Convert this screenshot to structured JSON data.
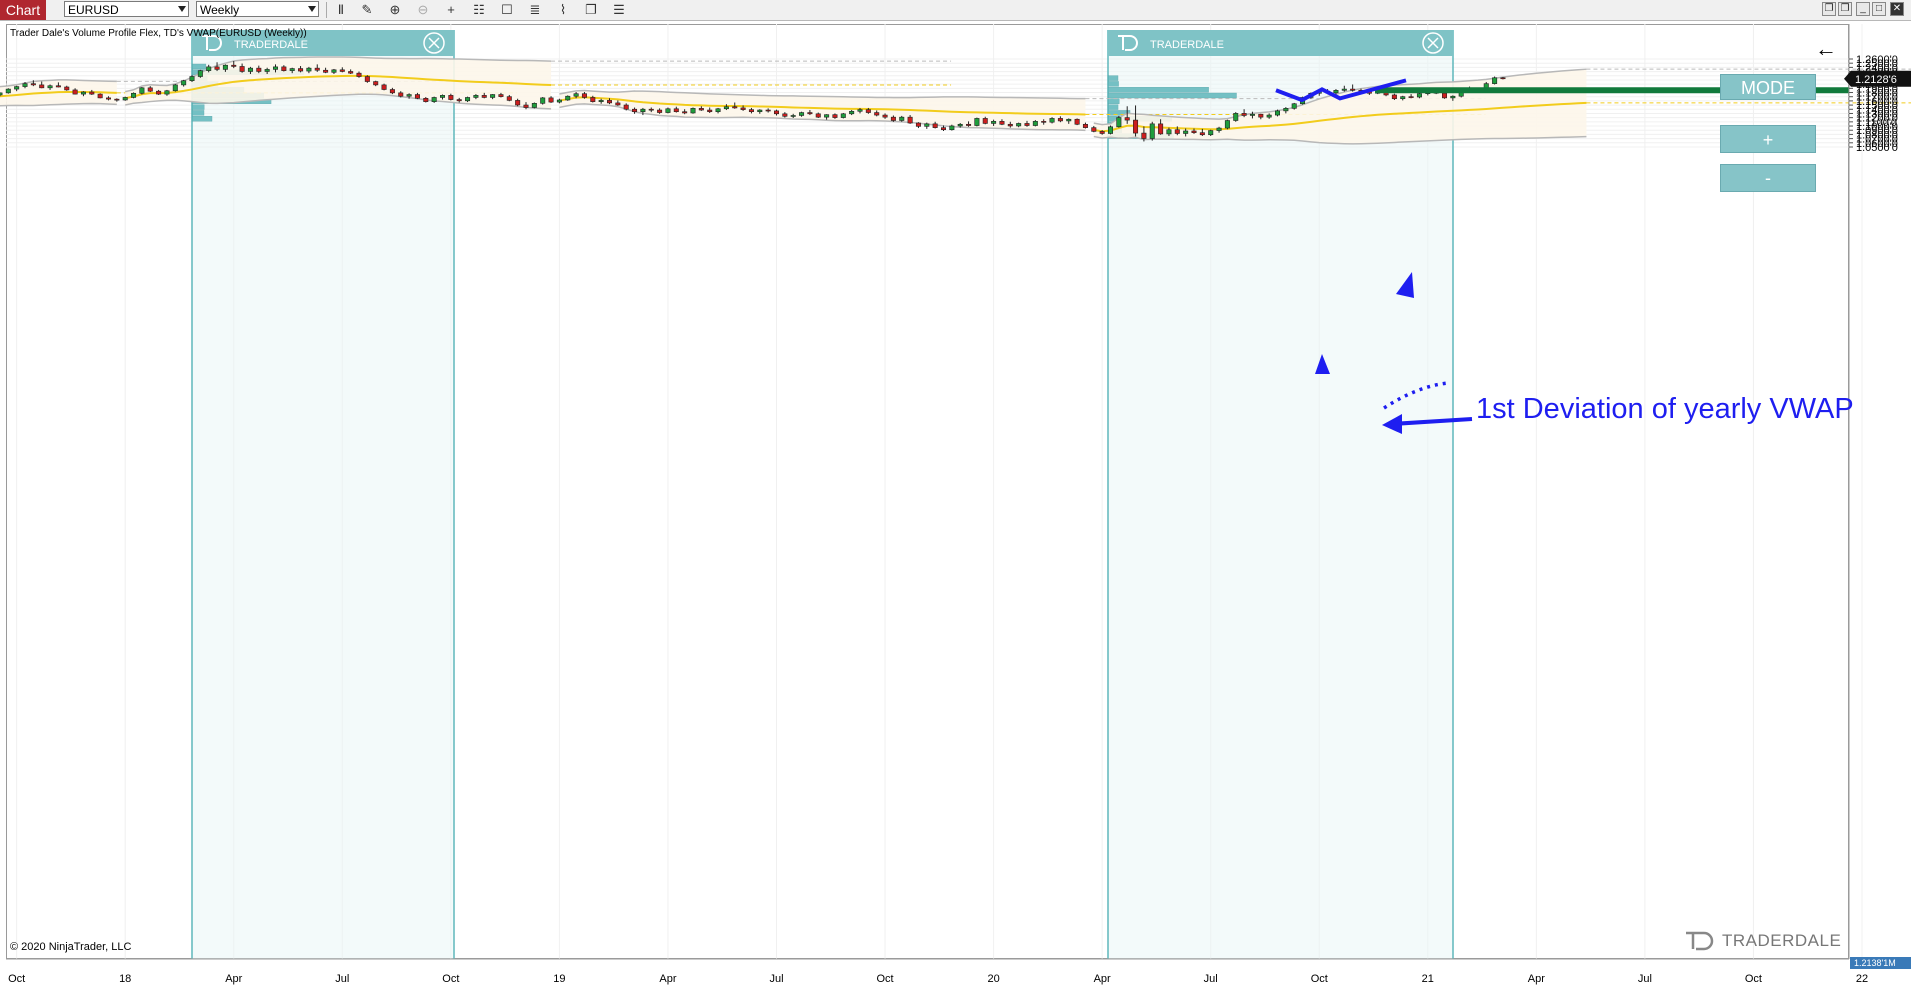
{
  "toolbar": {
    "tab_label": "Chart",
    "instrument": "EURUSD",
    "timeframe": "Weekly",
    "icons": [
      "bar-type-icon",
      "draw-pencil-icon",
      "zoom-in-icon",
      "zoom-out-icon",
      "crosshair-icon",
      "properties-icon",
      "data-box-icon",
      "strategy-icon",
      "indicator-icon",
      "menu-icon"
    ]
  },
  "window_buttons": [
    "restore",
    "restore",
    "minimize",
    "maximize",
    "close"
  ],
  "indicator_label": "Trader Dale's Volume Profile Flex, TD's VWAP(EURUSD (Weekly))",
  "copyright": "© 2020 NinjaTrader, LLC",
  "panel": {
    "mode": "MODE",
    "plus": "+",
    "minus": "-"
  },
  "profile_header_text": "TRADERDALE",
  "brand": "TRADERDALE",
  "annotation": "1st Deviation of yearly VWAP",
  "price_tag": "1.2128'6",
  "bottom_tag": "1.2138'1M",
  "colors": {
    "bull": "#1f9d3c",
    "bear": "#cc1e1e",
    "vwap": "#f2cc1c",
    "band": "#b8b8b8",
    "profile": "#5fb7bb",
    "profile_bg": "#eaf6f6",
    "annotation": "#1e1ef0",
    "level_line": "#117a3c",
    "brand_red": "#b0272f"
  },
  "chart_data": {
    "type": "candlestick",
    "instrument": "EURUSD",
    "timeframe": "Weekly",
    "y_axis_labels": [
      "1.2600'0",
      "1.2500'0",
      "1.2400'0",
      "1.2300'0",
      "1.2200'0",
      "1.2100'0",
      "1.2000'0",
      "1.1900'0",
      "1.1800'0",
      "1.1700'0",
      "1.1600'0",
      "1.1500'0",
      "1.1400'0",
      "1.1300'0",
      "1.1200'0",
      "1.1100'0",
      "1.1000'0",
      "1.0900'0",
      "1.0800'0",
      "1.0700'0",
      "1.0600'0",
      "1.0500'0"
    ],
    "y_axis_values": [
      1.26,
      1.25,
      1.24,
      1.23,
      1.22,
      1.21,
      1.2,
      1.19,
      1.18,
      1.17,
      1.16,
      1.15,
      1.14,
      1.13,
      1.12,
      1.11,
      1.1,
      1.09,
      1.08,
      1.07,
      1.06,
      1.05
    ],
    "ylim": [
      1.046,
      1.264
    ],
    "x_axis_labels": [
      "Oct",
      "18",
      "Apr",
      "Jul",
      "Oct",
      "19",
      "Apr",
      "Jul",
      "Oct",
      "20",
      "Apr",
      "Jul",
      "Oct",
      "21",
      "Apr",
      "Jul",
      "Oct",
      "22"
    ],
    "x_axis_weeks": [
      -1,
      12,
      25,
      38,
      51,
      64,
      77,
      90,
      103,
      116,
      129,
      142,
      155,
      168,
      181,
      194,
      207,
      220
    ],
    "week_range": [
      -12,
      225
    ],
    "last_price": 1.21286,
    "candles_ohlc": [
      [
        1.1468,
        1.1532,
        1.1432,
        1.1512
      ],
      [
        1.1512,
        1.1602,
        1.1482,
        1.1592
      ],
      [
        1.1592,
        1.1702,
        1.1572,
        1.1682
      ],
      [
        1.1682,
        1.1782,
        1.1652,
        1.1762
      ],
      [
        1.1762,
        1.1832,
        1.1722,
        1.1802
      ],
      [
        1.1802,
        1.1832,
        1.1742,
        1.1752
      ],
      [
        1.1752,
        1.1852,
        1.1712,
        1.1832
      ],
      [
        1.1832,
        1.1862,
        1.1752,
        1.1772
      ],
      [
        1.1772,
        1.1812,
        1.1722,
        1.1742
      ],
      [
        1.1742,
        1.1802,
        1.1712,
        1.1792
      ],
      [
        1.1792,
        1.1902,
        1.1772,
        1.1882
      ],
      [
        1.1882,
        1.1962,
        1.1832,
        1.1942
      ],
      [
        1.1942,
        1.2052,
        1.1902,
        1.2012
      ],
      [
        1.2012,
        1.2092,
        1.1952,
        1.1982
      ],
      [
        1.1982,
        1.2062,
        1.1902,
        1.1912
      ],
      [
        1.1912,
        1.1992,
        1.1862,
        1.1962
      ],
      [
        1.1962,
        1.2042,
        1.1922,
        1.1932
      ],
      [
        1.1932,
        1.1962,
        1.1842,
        1.1862
      ],
      [
        1.1862,
        1.1902,
        1.1752,
        1.1762
      ],
      [
        1.1762,
        1.1832,
        1.1712,
        1.1812
      ],
      [
        1.1812,
        1.1862,
        1.1742,
        1.1762
      ],
      [
        1.1762,
        1.1782,
        1.1662,
        1.1672
      ],
      [
        1.1672,
        1.1712,
        1.1612,
        1.1642
      ],
      [
        1.1642,
        1.1662,
        1.1582,
        1.1622
      ],
      [
        1.1622,
        1.1702,
        1.1602,
        1.1682
      ],
      [
        1.1682,
        1.1802,
        1.1662,
        1.1782
      ],
      [
        1.1782,
        1.1932,
        1.1752,
        1.1912
      ],
      [
        1.1912,
        1.1952,
        1.1812,
        1.1832
      ],
      [
        1.1832,
        1.1862,
        1.1742,
        1.1762
      ],
      [
        1.1762,
        1.1862,
        1.1722,
        1.1842
      ],
      [
        1.1842,
        1.2002,
        1.1822,
        1.1982
      ],
      [
        1.1982,
        1.2102,
        1.1942,
        1.2082
      ],
      [
        1.2082,
        1.2212,
        1.2052,
        1.2182
      ],
      [
        1.2182,
        1.2342,
        1.2152,
        1.2322
      ],
      [
        1.2322,
        1.2462,
        1.2282,
        1.2412
      ],
      [
        1.2412,
        1.2522,
        1.2312,
        1.2352
      ],
      [
        1.2352,
        1.2472,
        1.2292,
        1.2452
      ],
      [
        1.2452,
        1.2552,
        1.2382,
        1.2422
      ],
      [
        1.2422,
        1.2492,
        1.2272,
        1.2302
      ],
      [
        1.2302,
        1.2412,
        1.2242,
        1.2382
      ],
      [
        1.2382,
        1.2442,
        1.2262,
        1.2302
      ],
      [
        1.2302,
        1.2392,
        1.2242,
        1.2352
      ],
      [
        1.2352,
        1.2472,
        1.2282,
        1.2412
      ],
      [
        1.2412,
        1.2452,
        1.2302,
        1.2322
      ],
      [
        1.2322,
        1.2392,
        1.2262,
        1.2372
      ],
      [
        1.2372,
        1.2432,
        1.2282,
        1.2312
      ],
      [
        1.2312,
        1.2412,
        1.2262,
        1.2382
      ],
      [
        1.2382,
        1.2472,
        1.2292,
        1.2332
      ],
      [
        1.2332,
        1.2392,
        1.2262,
        1.2282
      ],
      [
        1.2282,
        1.2362,
        1.2242,
        1.2342
      ],
      [
        1.2342,
        1.2402,
        1.2282,
        1.2302
      ],
      [
        1.2302,
        1.2352,
        1.2242,
        1.2262
      ],
      [
        1.2262,
        1.2302,
        1.2152,
        1.2182
      ],
      [
        1.2182,
        1.2212,
        1.2032,
        1.2062
      ],
      [
        1.2062,
        1.2082,
        1.1952,
        1.1982
      ],
      [
        1.1982,
        1.2012,
        1.1852,
        1.1872
      ],
      [
        1.1872,
        1.1912,
        1.1762,
        1.1792
      ],
      [
        1.1792,
        1.1832,
        1.1682,
        1.1712
      ],
      [
        1.1712,
        1.1782,
        1.1652,
        1.1752
      ],
      [
        1.1752,
        1.1792,
        1.1642,
        1.1662
      ],
      [
        1.1662,
        1.1692,
        1.1562,
        1.1582
      ],
      [
        1.1582,
        1.1702,
        1.1552,
        1.1682
      ],
      [
        1.1682,
        1.1752,
        1.1632,
        1.1732
      ],
      [
        1.1732,
        1.1772,
        1.1612,
        1.1632
      ],
      [
        1.1632,
        1.1672,
        1.1562,
        1.1602
      ],
      [
        1.1602,
        1.1702,
        1.1572,
        1.1682
      ],
      [
        1.1682,
        1.1762,
        1.1642,
        1.1732
      ],
      [
        1.1732,
        1.1792,
        1.1662,
        1.1682
      ],
      [
        1.1682,
        1.1762,
        1.1642,
        1.1752
      ],
      [
        1.1752,
        1.1792,
        1.1682,
        1.1702
      ],
      [
        1.1702,
        1.1742,
        1.1592,
        1.1612
      ],
      [
        1.1612,
        1.1652,
        1.1472,
        1.1502
      ],
      [
        1.1502,
        1.1572,
        1.1402,
        1.1442
      ],
      [
        1.1442,
        1.1562,
        1.1422,
        1.1542
      ],
      [
        1.1542,
        1.1692,
        1.1512,
        1.1672
      ],
      [
        1.1672,
        1.1712,
        1.1552,
        1.1572
      ],
      [
        1.1572,
        1.1652,
        1.1542,
        1.1622
      ],
      [
        1.1622,
        1.1732,
        1.1602,
        1.1712
      ],
      [
        1.1712,
        1.1812,
        1.1662,
        1.1772
      ],
      [
        1.1772,
        1.1812,
        1.1652,
        1.1682
      ],
      [
        1.1682,
        1.1722,
        1.1562,
        1.1582
      ],
      [
        1.1582,
        1.1652,
        1.1532,
        1.1612
      ],
      [
        1.1612,
        1.1662,
        1.1522,
        1.1552
      ],
      [
        1.1552,
        1.1612,
        1.1482,
        1.1502
      ],
      [
        1.1502,
        1.1542,
        1.1372,
        1.1402
      ],
      [
        1.1402,
        1.1442,
        1.1292,
        1.1342
      ],
      [
        1.1342,
        1.1432,
        1.1262,
        1.1402
      ],
      [
        1.1402,
        1.1442,
        1.1332,
        1.1382
      ],
      [
        1.1382,
        1.1422,
        1.1292,
        1.1322
      ],
      [
        1.1322,
        1.1442,
        1.1302,
        1.1412
      ],
      [
        1.1412,
        1.1462,
        1.1322,
        1.1342
      ],
      [
        1.1342,
        1.1402,
        1.1282,
        1.1312
      ],
      [
        1.1312,
        1.1442,
        1.1292,
        1.1422
      ],
      [
        1.1422,
        1.1472,
        1.1362,
        1.1382
      ],
      [
        1.1382,
        1.1442,
        1.1312,
        1.1342
      ],
      [
        1.1342,
        1.1432,
        1.1302,
        1.1412
      ],
      [
        1.1412,
        1.1522,
        1.1382,
        1.1462
      ],
      [
        1.1462,
        1.1562,
        1.1412,
        1.1432
      ],
      [
        1.1432,
        1.1492,
        1.1362,
        1.1392
      ],
      [
        1.1392,
        1.1432,
        1.1302,
        1.1342
      ],
      [
        1.1342,
        1.1402,
        1.1292,
        1.1382
      ],
      [
        1.1382,
        1.1422,
        1.1322,
        1.1362
      ],
      [
        1.1362,
        1.1392,
        1.1252,
        1.1292
      ],
      [
        1.1292,
        1.1332,
        1.1202,
        1.1232
      ],
      [
        1.1232,
        1.1292,
        1.1192,
        1.1252
      ],
      [
        1.1252,
        1.1342,
        1.1222,
        1.1322
      ],
      [
        1.1322,
        1.1382,
        1.1262,
        1.1292
      ],
      [
        1.1292,
        1.1322,
        1.1192,
        1.1212
      ],
      [
        1.1212,
        1.1282,
        1.1152,
        1.1272
      ],
      [
        1.1272,
        1.1302,
        1.1172,
        1.1202
      ],
      [
        1.1202,
        1.1312,
        1.1182,
        1.1292
      ],
      [
        1.1292,
        1.1382,
        1.1262,
        1.1352
      ],
      [
        1.1352,
        1.1432,
        1.1302,
        1.1392
      ],
      [
        1.1392,
        1.1432,
        1.1292,
        1.1322
      ],
      [
        1.1322,
        1.1372,
        1.1232,
        1.1262
      ],
      [
        1.1262,
        1.1302,
        1.1172,
        1.1212
      ],
      [
        1.1212,
        1.1252,
        1.1102,
        1.1132
      ],
      [
        1.1132,
        1.1242,
        1.1102,
        1.1212
      ],
      [
        1.1212,
        1.1262,
        1.1052,
        1.1072
      ],
      [
        1.1072,
        1.1092,
        1.0952,
        1.0992
      ],
      [
        1.0992,
        1.1082,
        1.0932,
        1.1052
      ],
      [
        1.1052,
        1.1102,
        1.0942,
        1.0962
      ],
      [
        1.0962,
        1.1012,
        1.0882,
        1.0912
      ],
      [
        1.0912,
        1.1032,
        1.0892,
        1.1002
      ],
      [
        1.1002,
        1.1072,
        1.0962,
        1.1042
      ],
      [
        1.1042,
        1.1112,
        1.0982,
        1.1012
      ],
      [
        1.1012,
        1.1202,
        1.0992,
        1.1182
      ],
      [
        1.1182,
        1.1222,
        1.1042,
        1.1062
      ],
      [
        1.1062,
        1.1152,
        1.1002,
        1.1112
      ],
      [
        1.1112,
        1.1162,
        1.1022,
        1.1042
      ],
      [
        1.1042,
        1.1102,
        1.0962,
        1.1002
      ],
      [
        1.1002,
        1.1082,
        1.0972,
        1.1062
      ],
      [
        1.1062,
        1.1122,
        1.0982,
        1.1012
      ],
      [
        1.1012,
        1.1142,
        1.0992,
        1.1112
      ],
      [
        1.1112,
        1.1162,
        1.1032,
        1.1092
      ],
      [
        1.1092,
        1.1212,
        1.1062,
        1.1182
      ],
      [
        1.1182,
        1.1232,
        1.1092,
        1.1122
      ],
      [
        1.1122,
        1.1182,
        1.1052,
        1.1162
      ],
      [
        1.1162,
        1.1182,
        1.1022,
        1.1042
      ],
      [
        1.1042,
        1.1082,
        1.0942,
        1.0962
      ],
      [
        1.0962,
        1.1002,
        1.0852,
        1.0872
      ],
      [
        1.0872,
        1.0902,
        1.0792,
        1.0822
      ],
      [
        1.0822,
        1.1012,
        1.0802,
        1.0982
      ],
      [
        1.0982,
        1.1242,
        1.0962,
        1.1202
      ],
      [
        1.1202,
        1.1472,
        1.1052,
        1.1142
      ],
      [
        1.1142,
        1.1492,
        1.0752,
        1.0832
      ],
      [
        1.0832,
        1.0992,
        1.0632,
        1.0702
      ],
      [
        1.0702,
        1.1102,
        1.0652,
        1.1052
      ],
      [
        1.1052,
        1.1162,
        1.0792,
        1.0812
      ],
      [
        1.0812,
        1.0962,
        1.0762,
        1.0912
      ],
      [
        1.0912,
        1.0992,
        1.0782,
        1.0822
      ],
      [
        1.0822,
        1.0942,
        1.0752,
        1.0882
      ],
      [
        1.0882,
        1.0942,
        1.0812,
        1.0842
      ],
      [
        1.0842,
        1.0932,
        1.0762,
        1.0792
      ],
      [
        1.0792,
        1.0912,
        1.0762,
        1.0892
      ],
      [
        1.0892,
        1.0982,
        1.0842,
        1.0952
      ],
      [
        1.0952,
        1.1152,
        1.0922,
        1.1132
      ],
      [
        1.1132,
        1.1332,
        1.1102,
        1.1302
      ],
      [
        1.1302,
        1.1402,
        1.1212,
        1.1252
      ],
      [
        1.1252,
        1.1342,
        1.1182,
        1.1282
      ],
      [
        1.1282,
        1.1292,
        1.1162,
        1.1212
      ],
      [
        1.1212,
        1.1302,
        1.1172,
        1.1262
      ],
      [
        1.1262,
        1.1392,
        1.1232,
        1.1362
      ],
      [
        1.1362,
        1.1452,
        1.1302,
        1.1422
      ],
      [
        1.1422,
        1.1552,
        1.1392,
        1.1532
      ],
      [
        1.1532,
        1.1702,
        1.1512,
        1.1682
      ],
      [
        1.1682,
        1.1802,
        1.1652,
        1.1782
      ],
      [
        1.1782,
        1.1862,
        1.1722,
        1.1832
      ],
      [
        1.1832,
        1.1882,
        1.1762,
        1.1792
      ],
      [
        1.1792,
        1.1882,
        1.1742,
        1.1852
      ],
      [
        1.1852,
        1.1962,
        1.1822,
        1.1882
      ],
      [
        1.1882,
        1.1992,
        1.1822,
        1.1852
      ],
      [
        1.1852,
        1.1892,
        1.1802,
        1.1832
      ],
      [
        1.1832,
        1.1882,
        1.1742,
        1.1782
      ],
      [
        1.1782,
        1.1872,
        1.1762,
        1.1832
      ],
      [
        1.1832,
        1.1862,
        1.1712,
        1.1742
      ],
      [
        1.1742,
        1.1772,
        1.1622,
        1.1652
      ],
      [
        1.1652,
        1.1722,
        1.1612,
        1.1702
      ],
      [
        1.1702,
        1.1762,
        1.1662,
        1.1692
      ],
      [
        1.1692,
        1.1792,
        1.1662,
        1.1772
      ],
      [
        1.1772,
        1.1882,
        1.1732,
        1.1862
      ],
      [
        1.1862,
        1.1882,
        1.1762,
        1.1782
      ],
      [
        1.1782,
        1.1822,
        1.1652,
        1.1672
      ],
      [
        1.1672,
        1.1732,
        1.1602,
        1.1712
      ],
      [
        1.1712,
        1.1902,
        1.1682,
        1.1882
      ],
      [
        1.1882,
        1.1942,
        1.1822,
        1.1852
      ],
      [
        1.1852,
        1.1902,
        1.1822,
        1.1882
      ],
      [
        1.1882,
        1.2052,
        1.1862,
        1.2012
      ],
      [
        1.2012,
        1.2182,
        1.1992,
        1.2152
      ],
      [
        1.2152,
        1.2172,
        1.2112,
        1.21286
      ]
    ],
    "horizontal_level": 1.1855,
    "volume_profile_ranges": [
      {
        "from_week": 12,
        "to_week": 40
      },
      {
        "from_week": 128,
        "to_week": 163
      }
    ]
  }
}
